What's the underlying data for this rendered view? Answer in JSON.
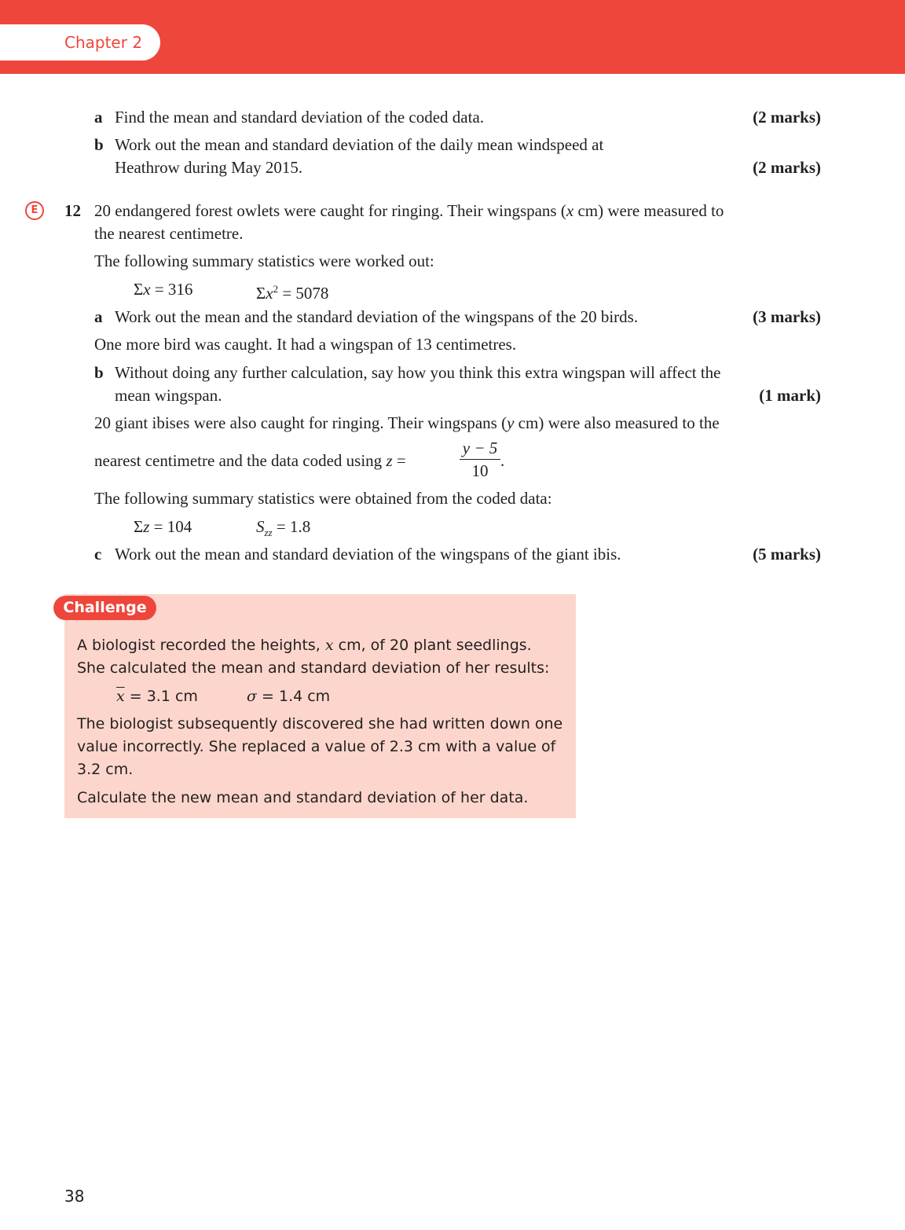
{
  "header": {
    "chapter": "Chapter 2"
  },
  "q11": {
    "a": {
      "label": "a",
      "text": "Find the mean and standard deviation of the coded data.",
      "marks": "(2 marks)"
    },
    "b": {
      "label": "b",
      "line1": "Work out the mean and standard deviation of the daily mean windspeed at",
      "line2": "Heathrow during May 2015.",
      "marks": "(2 marks)"
    }
  },
  "q12": {
    "badge": "E",
    "number": "12",
    "intro1_pre": "20 endangered forest owlets were caught for ringing. Their wingspans (",
    "intro1_var": "x",
    "intro1_post": " cm) were measured to",
    "intro2": "the nearest centimetre.",
    "summary_intro": "The following summary statistics were worked out:",
    "stat1_sym": "Σ",
    "stat1_var": "x",
    "stat1_val": " = 316",
    "stat2_sym": "Σ",
    "stat2_var": "x",
    "stat2_exp": "2",
    "stat2_val": " = 5078",
    "a": {
      "label": "a",
      "text": "Work out the mean and the standard deviation of the wingspans of the 20 birds.",
      "marks": "(3 marks)"
    },
    "extra_bird": "One more bird was caught. It had a wingspan of 13 centimetres.",
    "b": {
      "label": "b",
      "line1": "Without doing any further calculation, say how you think this extra wingspan will affect the",
      "line2": "mean wingspan.",
      "marks": "(1 mark)"
    },
    "ibis1_pre": "20 giant ibises were also caught for ringing. Their wingspans (",
    "ibis1_var": "y",
    "ibis1_post": " cm) were also measured to the",
    "ibis2_pre": "nearest centimetre and the data coded using ",
    "ibis2_var": "z",
    "ibis2_eq": " =",
    "frac_num": "y − 5",
    "frac_den": "10",
    "ibis2_end": ".",
    "coded_intro": "The following summary statistics were obtained from the coded data:",
    "stat3_sym": "Σ",
    "stat3_var": "z",
    "stat3_val": " = 104",
    "stat4_var": "S",
    "stat4_sub": "zz",
    "stat4_val": " = 1.8",
    "c": {
      "label": "c",
      "text": "Work out the mean and standard deviation of the wingspans of the giant ibis.",
      "marks": "(5 marks)"
    }
  },
  "challenge": {
    "title": "Challenge",
    "line1_pre": "A biologist recorded the heights, ",
    "line1_var": "x",
    "line1_post": " cm, of 20 plant seedlings.",
    "line2": "She calculated the mean and standard deviation of her results:",
    "mean_var": "x",
    "mean_val": " = 3.1 cm",
    "sd_var": "σ",
    "sd_val": " = 1.4 cm",
    "line3": "The biologist subsequently discovered she had written down one",
    "line4": "value incorrectly. She replaced a value of 2.3 cm with a value of",
    "line5": "3.2 cm.",
    "line6": "Calculate the new mean and standard deviation of her data."
  },
  "footer": {
    "page_number": "38"
  }
}
